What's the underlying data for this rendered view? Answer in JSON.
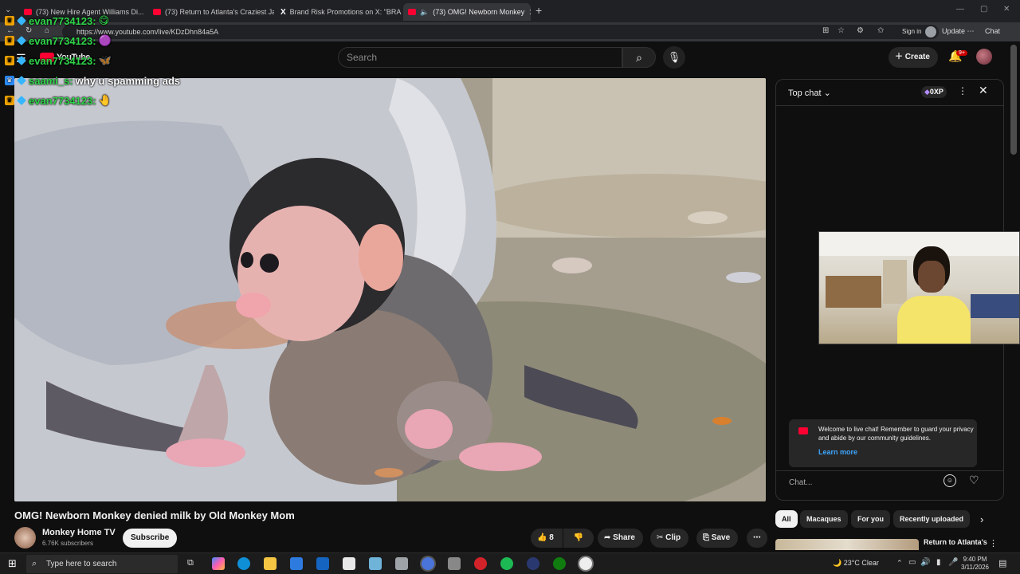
{
  "browser": {
    "tabs": [
      {
        "title": "(73) New Hire Agent Williams Di...",
        "icon": "youtube-icon"
      },
      {
        "title": "(73) Return to Atlanta's Craziest Ja",
        "icon": "youtube-icon"
      },
      {
        "title": "Brand Risk Promotions on X: \"BRA",
        "icon": "x-icon"
      },
      {
        "title": "(73) OMG! Newborn Monkey",
        "icon": "youtube-icon"
      }
    ],
    "url": "https://www.youtube.com/live/KDzDhn84a5A",
    "sign_in": "Sign in",
    "update": "Update",
    "chat": "Chat"
  },
  "overlay_chat": [
    {
      "user": "evan7734123:",
      "message": "",
      "emote": "😋"
    },
    {
      "user": "evan7734123:",
      "message": "",
      "emote": "🟣"
    },
    {
      "user": "evan7734123:",
      "message": "",
      "emote": "🦋"
    },
    {
      "user": "saami_s:",
      "message": "why u spamming ads",
      "emote": ""
    },
    {
      "user": "evan7734123:",
      "message": "",
      "emote": "🤚"
    }
  ],
  "youtube": {
    "logo": "YouTube",
    "search_placeholder": "Search",
    "create_label": "Create",
    "notif_count": "9+"
  },
  "video": {
    "title": "OMG! Newborn Monkey denied milk by Old Monkey Mom",
    "channel": "Monkey Home TV",
    "subscribers": "6.76K subscribers",
    "subscribe_label": "Subscribe",
    "likes": "8",
    "share_label": "Share",
    "clip_label": "Clip",
    "save_label": "Save"
  },
  "live_chat": {
    "header": "Top chat",
    "xp_badge": "0XP",
    "welcome_text": "Welcome to live chat! Remember to guard your privacy and abide by our community guidelines.",
    "learn_more": "Learn more",
    "input_placeholder": "Chat..."
  },
  "related": {
    "chips": [
      "All",
      "Macaques",
      "For you",
      "Recently uploaded"
    ],
    "first_title": "Return to Atlanta's"
  },
  "taskbar": {
    "search_placeholder": "Type here to search",
    "weather": "23°C  Clear",
    "time": "9:40 PM",
    "date": "3/11/2026"
  }
}
